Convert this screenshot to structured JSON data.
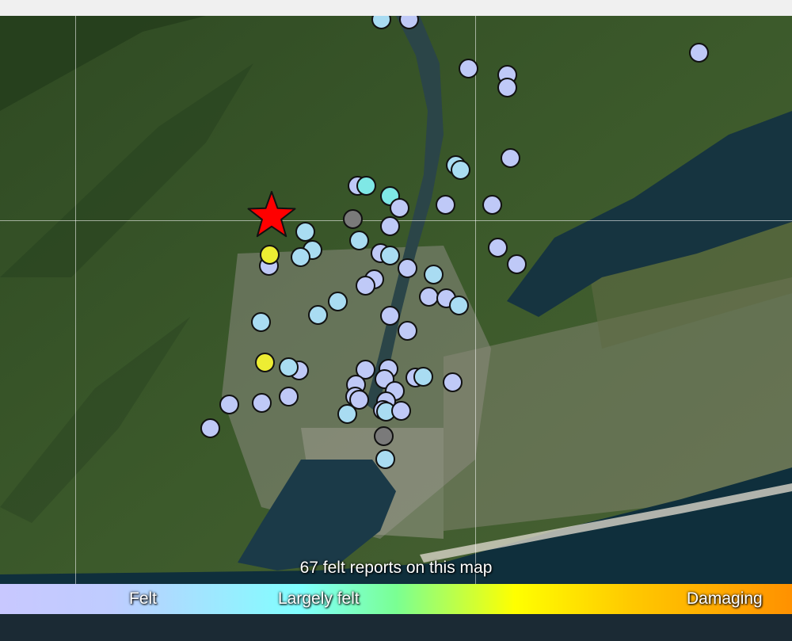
{
  "map": {
    "felt_report_count_text": "67 felt reports on this map",
    "epicenter": {
      "marker_color": "#ff0000",
      "icon": "star-icon"
    },
    "legend": {
      "labels": [
        "Felt",
        "Largely felt",
        "Damaging"
      ],
      "gradient_colors": [
        "#c8c8ff",
        "#a0e6ff",
        "#80ffff",
        "#7aff93",
        "#ffff00",
        "#ffc800",
        "#ff9100"
      ]
    },
    "report_colors": {
      "felt": "#bfc9f7",
      "weak": "#a9dcf2",
      "largely_felt": "#7fe8e6",
      "strong": "#eded33",
      "unknown": "#7a7a7a"
    }
  }
}
